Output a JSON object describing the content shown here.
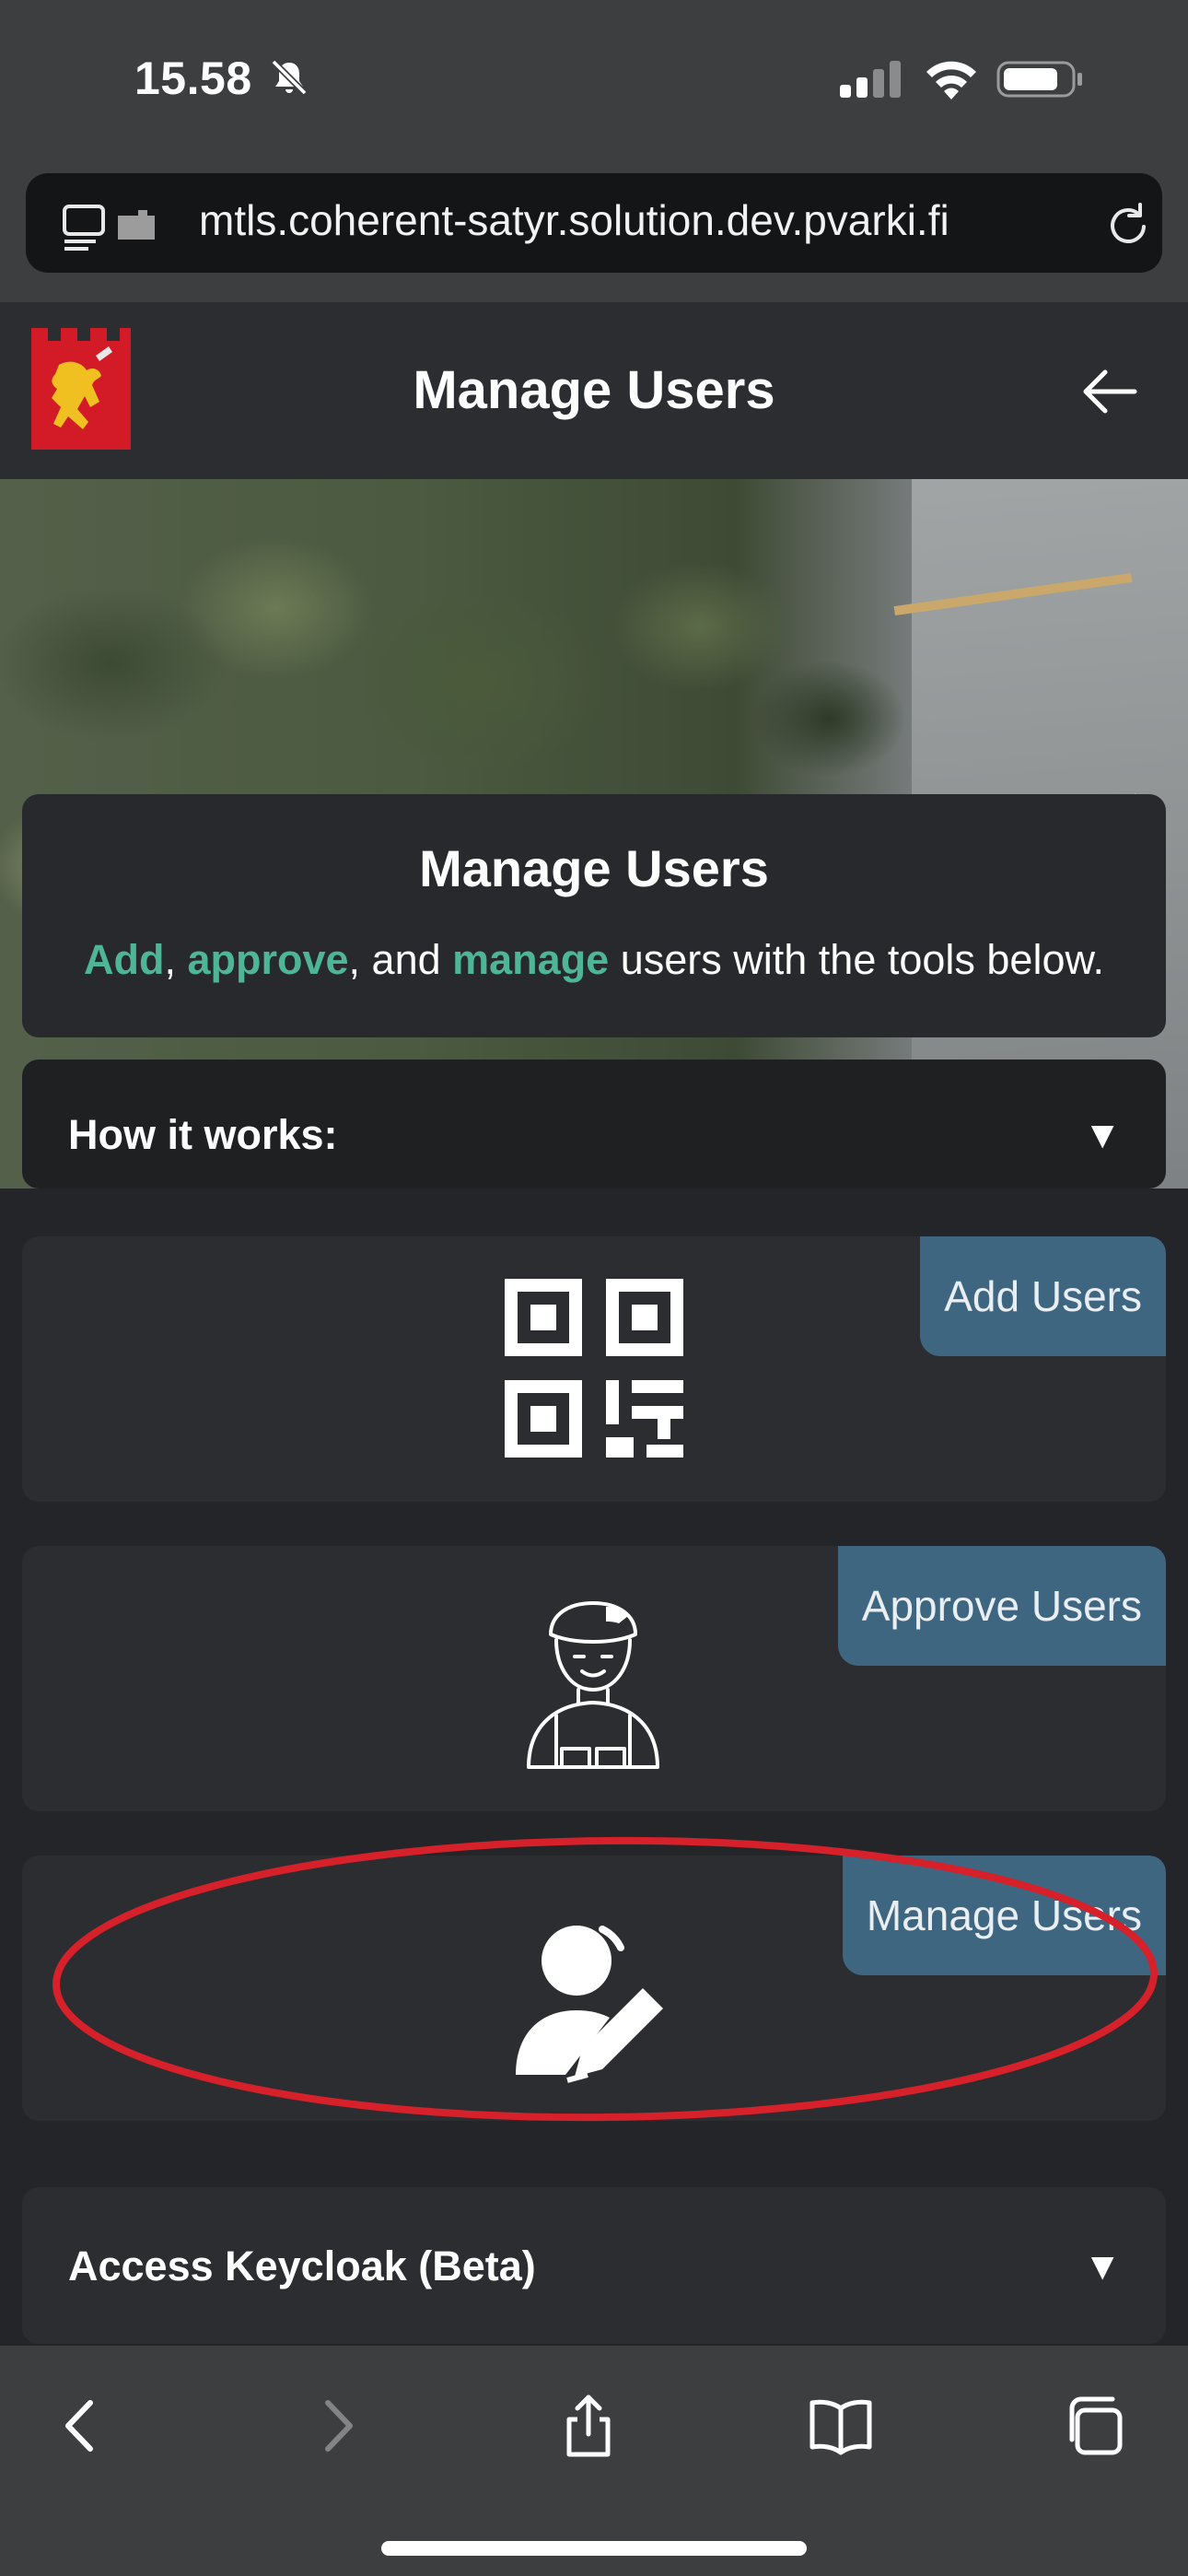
{
  "status_bar": {
    "time": "15.58",
    "icons": [
      "bell-slash-icon",
      "signal-icon",
      "wifi-icon",
      "battery-icon"
    ]
  },
  "browser": {
    "url": "mtls.coherent-satyr.solution.dev.pvarki.fi",
    "icons": [
      "page-format-icon",
      "reload-icon"
    ]
  },
  "header": {
    "title": "Manage Users",
    "icons": [
      "logo-lion-emblem",
      "back-arrow-icon"
    ]
  },
  "intro": {
    "title": "Manage Users",
    "text_parts": {
      "add": "Add",
      "sep1": ", ",
      "approve": "approve",
      "sep2": ", and ",
      "manage": "manage",
      "rest": " users with the tools below."
    },
    "accent_color": "#4fb597"
  },
  "how_it_works": {
    "label": "How it works:",
    "toggle": "▼"
  },
  "features": [
    {
      "label": "Add Users",
      "icon": "qr-code-icon"
    },
    {
      "label": "Approve Users",
      "icon": "soldier-avatar-icon"
    },
    {
      "label": "Manage Users",
      "icon": "user-edit-icon"
    }
  ],
  "keycloak": {
    "label": "Access Keycloak (Beta)",
    "toggle": "▼"
  },
  "toolbar": {
    "icons": [
      "back-icon",
      "forward-icon",
      "share-icon",
      "bookmarks-icon",
      "tabs-icon"
    ]
  },
  "colors": {
    "background": "#232528",
    "card": "#2b2d31",
    "tab": "#3f6680",
    "annotation": "#d6202a"
  }
}
